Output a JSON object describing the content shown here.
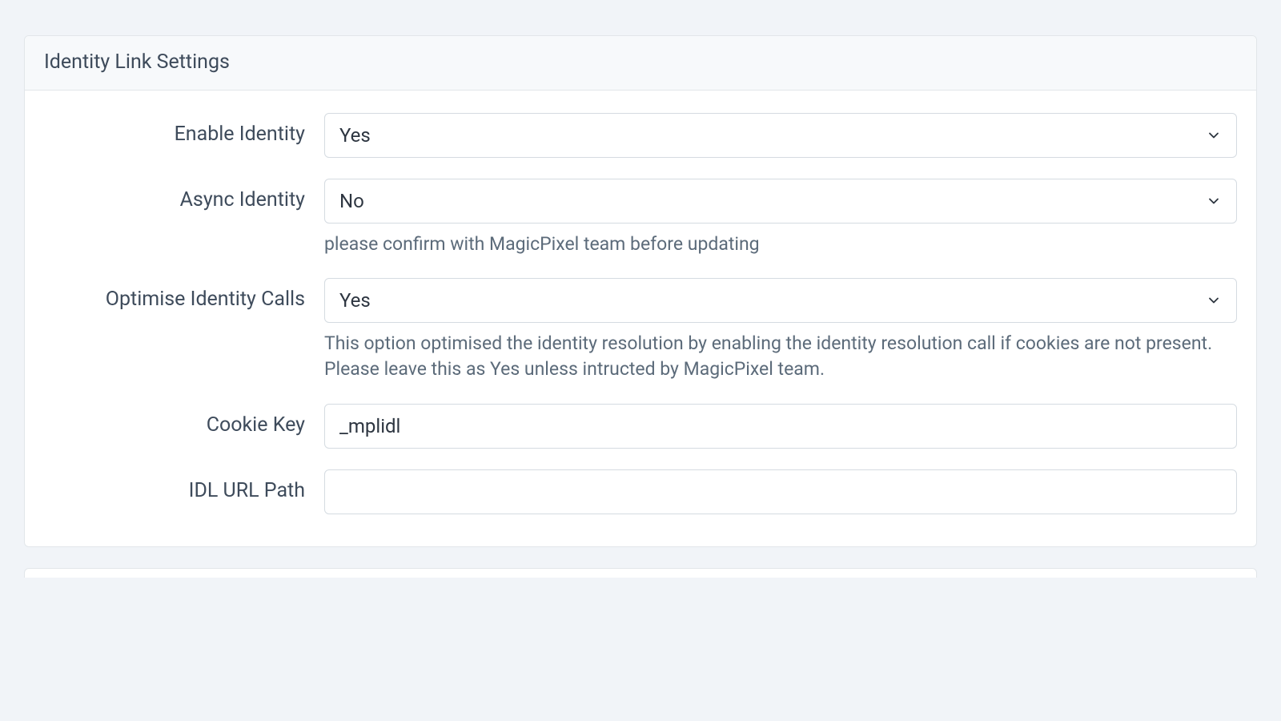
{
  "panel": {
    "title": "Identity Link Settings"
  },
  "fields": {
    "enableIdentity": {
      "label": "Enable Identity",
      "value": "Yes"
    },
    "asyncIdentity": {
      "label": "Async Identity",
      "value": "No",
      "help": "please confirm with MagicPixel team before updating"
    },
    "optimiseIdentityCalls": {
      "label": "Optimise Identity Calls",
      "value": "Yes",
      "help": "This option optimised the identity resolution by enabling the identity resolution call if cookies are not present. Please leave this as Yes unless intructed by MagicPixel team."
    },
    "cookieKey": {
      "label": "Cookie Key",
      "value": "_mplidl"
    },
    "idlUrlPath": {
      "label": "IDL URL Path",
      "value": ""
    }
  }
}
